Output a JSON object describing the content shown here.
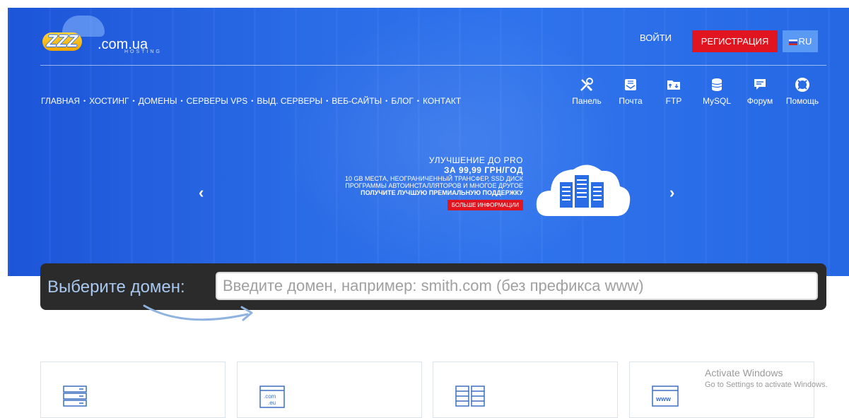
{
  "header": {
    "logo_brand": "ZZZ",
    "logo_domain": ".com.ua",
    "logo_sub": "HOSTING",
    "login": "ВОЙТИ",
    "register": "РЕГИСТРАЦИЯ",
    "language": "RU"
  },
  "nav": {
    "items": [
      {
        "label": "ГЛАВНАЯ"
      },
      {
        "label": "ХОСТИНГ"
      },
      {
        "label": "ДОМЕНЫ"
      },
      {
        "label": "СЕРВЕРЫ VPS"
      },
      {
        "label": "ВЫД. СЕРВЕРЫ"
      },
      {
        "label": "ВЕБ-САЙТЫ"
      },
      {
        "label": "БЛОГ"
      },
      {
        "label": "КОНТАКТ"
      }
    ]
  },
  "tools": [
    {
      "label": "Панель",
      "icon": "tools-icon"
    },
    {
      "label": "Почта",
      "icon": "mail-icon"
    },
    {
      "label": "FTP",
      "icon": "ftp-folder-icon"
    },
    {
      "label": "MySQL",
      "icon": "database-icon"
    },
    {
      "label": "Форум",
      "icon": "forum-icon"
    },
    {
      "label": "Помощь",
      "icon": "lifebuoy-icon"
    }
  ],
  "promo": {
    "line1": "УЛУЧШЕНИЕ ДО PRO",
    "line2": "ЗА 99,99 ГРН/ГОД",
    "line3": "10 GB МЕСТА, НЕОГРАНИЧЕННЫЙ ТРАНСФЕР, SSD ДИСК",
    "line4": "ПРОГРАММЫ АВТОИНСТАЛЛЯТОРОВ И МНОГОЕ ДРУГОЕ",
    "line5": "ПОЛУЧИТЕ ЛУЧШУЮ ПРЕМИАЛЬНУЮ ПОДДЕРЖКУ",
    "more": "БОЛЬШЕ ИНФОРМАЦИИ",
    "prev": "‹",
    "next": "›"
  },
  "domain_search": {
    "label": "Выберите домен:",
    "placeholder": "Введите домен, например: smith.com (без префикса www)",
    "value": ""
  },
  "cards": [
    {
      "icon": "server-stack-icon"
    },
    {
      "icon": "domain-com-eu-icon",
      "text1": ".com",
      "text2": ".eu"
    },
    {
      "icon": "server-racks-icon"
    },
    {
      "icon": "www-window-icon",
      "text": "www"
    }
  ],
  "watermark": {
    "title": "Activate Windows",
    "subtitle": "Go to Settings to activate Windows."
  },
  "colors": {
    "hero_blue": "#2a6be6",
    "register_red": "#e0151f",
    "lang_blue": "#5a9af5",
    "domain_bar": "#2b2b2b"
  }
}
